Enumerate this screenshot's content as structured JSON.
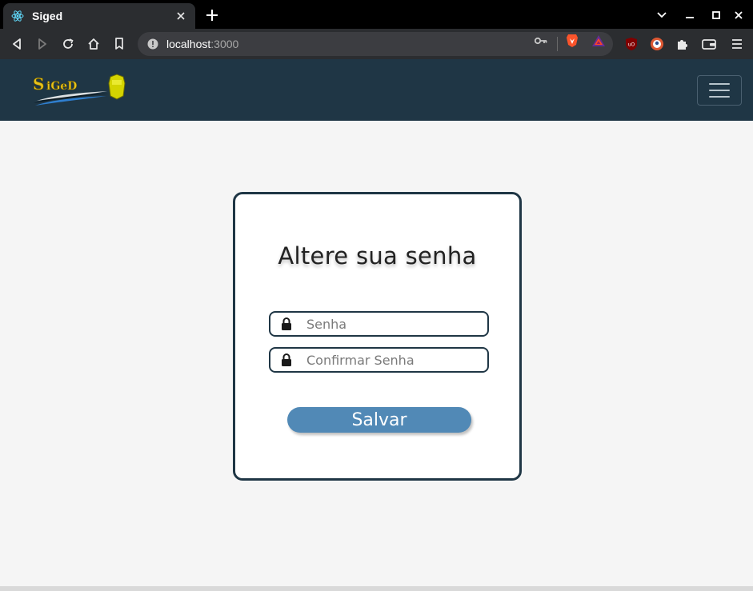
{
  "browser": {
    "tab_title": "Siged",
    "url_host": "localhost",
    "url_port": ":3000",
    "tab_icon": "react-atom-icon",
    "theme_colors": {
      "tabstrip": "#000000",
      "toolbar": "#2b2d30",
      "omnibox": "#3c3d41"
    }
  },
  "navbar": {
    "logo_text": "SiGeD",
    "background": "#1f3645",
    "menu_icon": "hamburger-icon"
  },
  "form": {
    "title": "Altere sua senha",
    "password_placeholder": "Senha",
    "confirm_placeholder": "Confirmar Senha",
    "field_icon": "lock-icon",
    "submit_label": "Salvar",
    "accent": "#5189b6",
    "border": "#1f3645"
  }
}
